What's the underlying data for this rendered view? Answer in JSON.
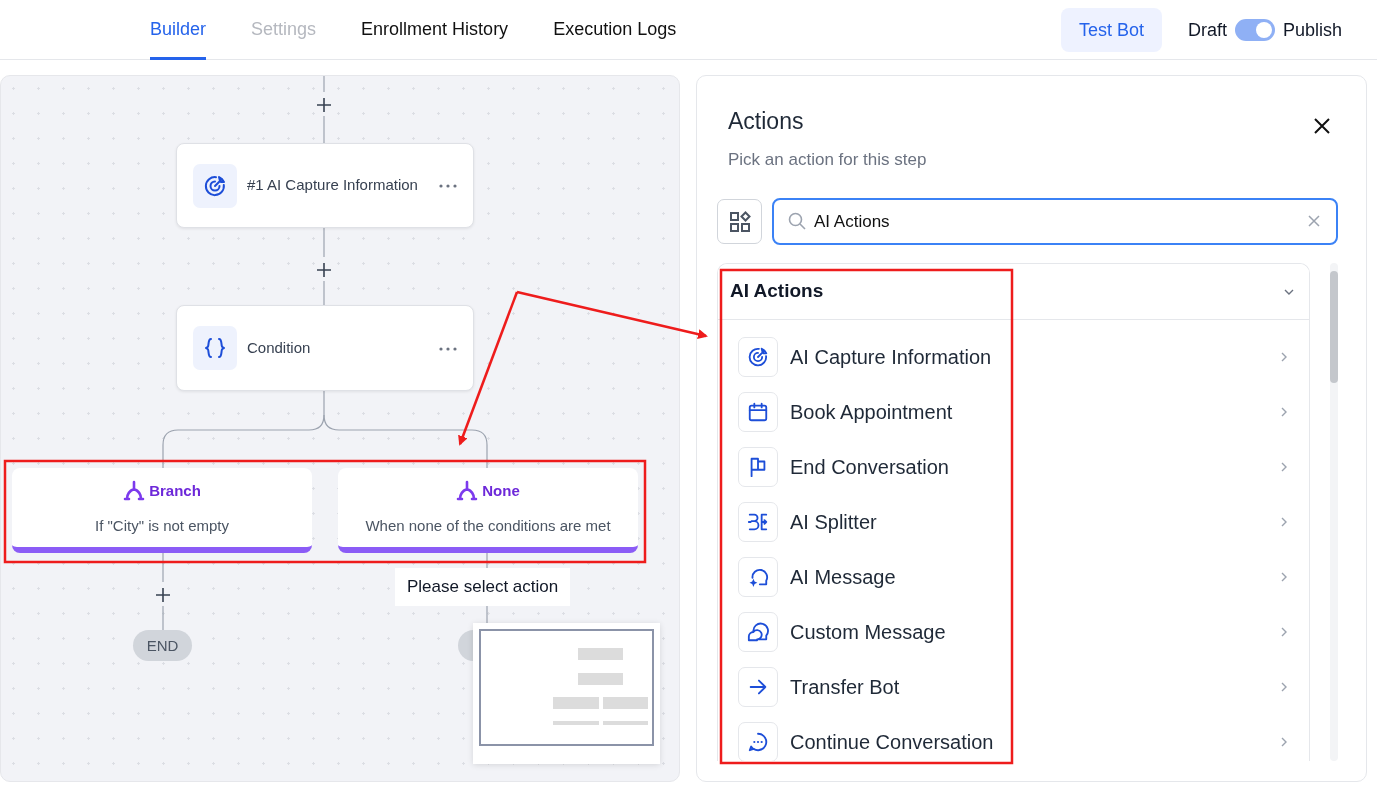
{
  "tabs": [
    {
      "label": "Builder",
      "selected": true,
      "disabled": false
    },
    {
      "label": "Settings",
      "selected": false,
      "disabled": true
    },
    {
      "label": "Enrollment History",
      "selected": false,
      "disabled": false
    },
    {
      "label": "Execution Logs",
      "selected": false,
      "disabled": false
    }
  ],
  "test_button": "Test Bot",
  "publish_toggle": {
    "off_label": "Draft",
    "on_label": "Publish",
    "on": true
  },
  "canvas": {
    "steps": [
      {
        "title": "#1 AI Capture Information"
      },
      {
        "title": "Condition"
      }
    ],
    "branches": [
      {
        "title": "Branch",
        "description": "If \"City\" is not empty"
      },
      {
        "title": "None",
        "description": "When none of the conditions are met"
      }
    ],
    "end_label": "END",
    "tooltip": "Please select action"
  },
  "panel": {
    "title": "Actions",
    "subtitle": "Pick an action for this step",
    "search": {
      "value": "AI Actions"
    },
    "section": {
      "title": "AI Actions",
      "expanded": true
    },
    "items": [
      {
        "label": "AI Capture Information"
      },
      {
        "label": "Book Appointment"
      },
      {
        "label": "End Conversation"
      },
      {
        "label": "AI Splitter"
      },
      {
        "label": "AI Message"
      },
      {
        "label": "Custom Message"
      },
      {
        "label": "Transfer Bot"
      },
      {
        "label": "Continue Conversation"
      }
    ]
  }
}
